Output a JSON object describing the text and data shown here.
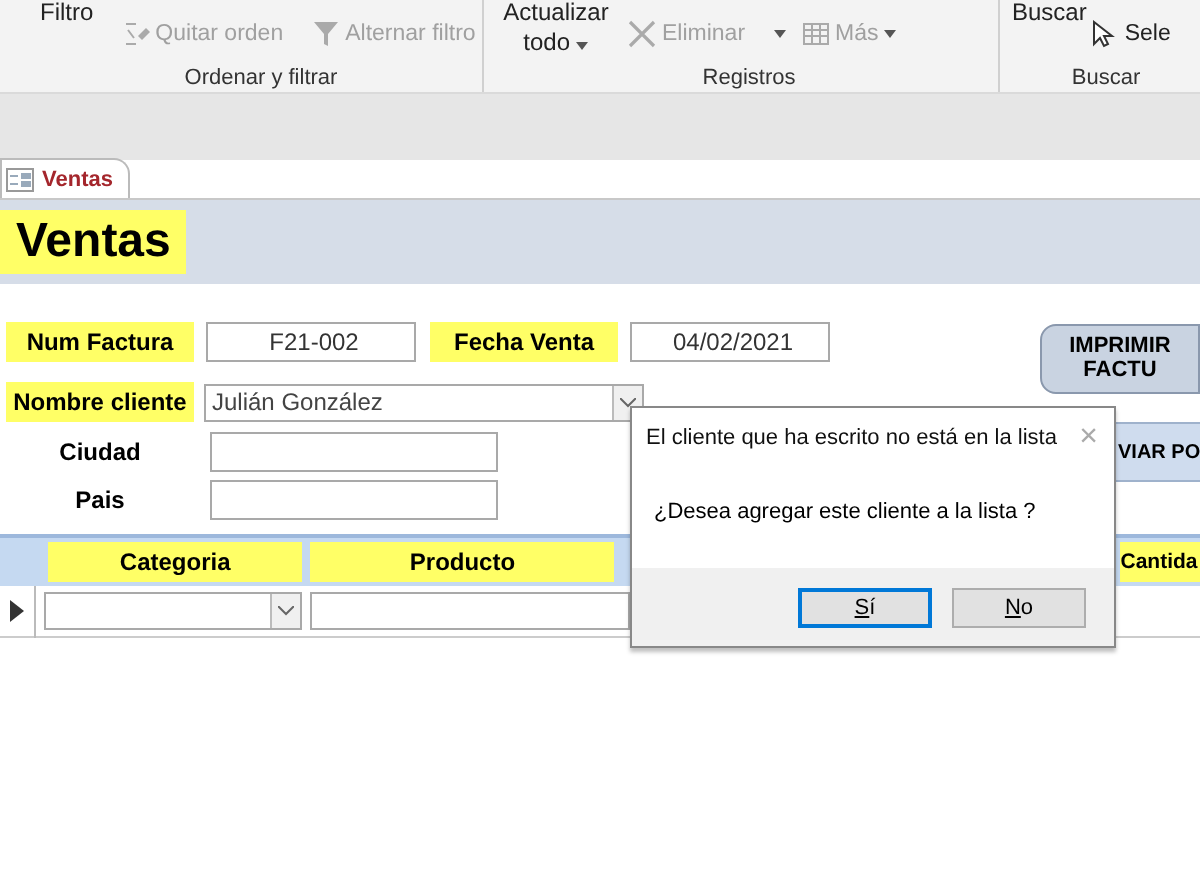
{
  "ribbon": {
    "groups": [
      {
        "label": "Ordenar y filtrar",
        "commands": [
          {
            "kind": "large",
            "label": "Filtro",
            "disabled": false
          },
          {
            "kind": "sort",
            "label": "Quitar orden",
            "disabled": true
          },
          {
            "kind": "filter",
            "label": "Alternar filtro",
            "disabled": true
          }
        ]
      },
      {
        "label": "Registros",
        "commands": [
          {
            "kind": "large-dropdown",
            "label": "Actualizar todo",
            "disabled": false
          },
          {
            "kind": "delete",
            "label": "Eliminar",
            "disabled": true
          },
          {
            "kind": "more",
            "label": "Más",
            "disabled": true
          }
        ]
      },
      {
        "label": "Buscar",
        "commands": [
          {
            "kind": "large",
            "label": "Buscar",
            "disabled": false
          },
          {
            "kind": "select",
            "label": "Sele",
            "disabled": false
          }
        ]
      }
    ]
  },
  "document_tab": {
    "label": "Ventas",
    "selected": true
  },
  "form": {
    "title": "Ventas",
    "num_factura": {
      "label": "Num Factura",
      "value": "F21-002"
    },
    "fecha_venta": {
      "label": "Fecha Venta",
      "value": "04/02/2021"
    },
    "nombre_cliente": {
      "label": "Nombre cliente",
      "value": "Julián González"
    },
    "ciudad": {
      "label": "Ciudad"
    },
    "pais": {
      "label": "Pais"
    },
    "buttons": [
      {
        "kind": "print",
        "label": "IMPRIMIR\nFACTU"
      },
      {
        "kind": "send",
        "label": "VIAR PO"
      }
    ],
    "subform": {
      "columns": [
        "Categoria",
        "Producto",
        "Cantida"
      ]
    }
  },
  "dialog": {
    "title": "El cliente que ha escrito no está en la lista",
    "message": "¿Desea agregar este cliente a la lista ?",
    "close": "×",
    "buttons": [
      {
        "label": "Sí",
        "selected": true
      },
      {
        "label": "No",
        "selected": false
      }
    ]
  }
}
